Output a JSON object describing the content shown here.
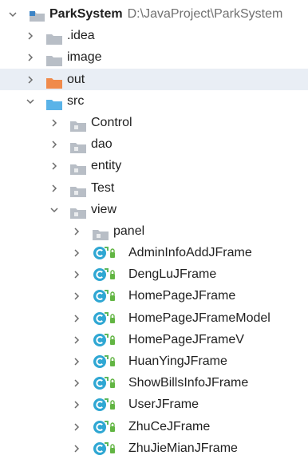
{
  "project": {
    "name": "ParkSystem",
    "path": "D:\\JavaProject\\ParkSystem"
  },
  "folders": {
    "idea": ".idea",
    "image": "image",
    "out": "out",
    "src": "src",
    "control": "Control",
    "dao": "dao",
    "entity": "entity",
    "test": "Test",
    "view": "view",
    "panel": "panel"
  },
  "classes": [
    "AdminInfoAddJFrame",
    "DengLuJFrame",
    "HomePageJFrame",
    "HomePageJFrameModel",
    "HomePageJFrameV",
    "HuanYingJFrame",
    "ShowBillsInfoJFrame",
    "UserJFrame",
    "ZhuCeJFrame",
    "ZhuJieMianJFrame"
  ],
  "colors": {
    "folder_plain": "#b8bec6",
    "folder_source": "#5ab3e8",
    "folder_excluded": "#f08a4b",
    "package": "#b8bec6",
    "class_circle": "#2fa7d3",
    "class_arrow": "#5cb85c",
    "access_badge": "#62b543",
    "selection": "#e9eef5"
  },
  "icons": {
    "expanded": "chevron-down-icon",
    "collapsed": "chevron-right-icon",
    "module": "module-folder-icon",
    "folder": "folder-icon",
    "package": "package-icon",
    "class": "java-class-icon"
  }
}
